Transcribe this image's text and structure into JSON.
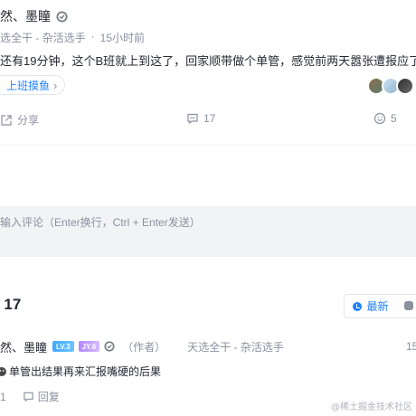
{
  "post": {
    "author": "然、墨瞳",
    "meta_title": "选全干 - 杂活选手",
    "meta_sep": "·",
    "time": "15小时前",
    "content": "还有19分钟，这个B班就上到这了，回家顺带做个单管，感觉前两天嚣张遭报应了",
    "topic": "上班摸鱼",
    "topic_more": "›"
  },
  "actions": {
    "share": "分享",
    "comments": "17",
    "likes": "5"
  },
  "comment_input": {
    "placeholder": "输入评论（Enter换行，Ctrl + Enter发送）"
  },
  "comments_section": {
    "title": "; 17",
    "sort_newest": "最新"
  },
  "reply": {
    "author": "然、墨瞳",
    "level_badge": "LV.3",
    "jy_badge": "JY.6",
    "author_tag": "（作者）",
    "title": "天选全干 - 杂活选手",
    "time": "15",
    "text": "单管出结果再来汇报嘴硬的后果",
    "likes": "1",
    "reply_label": "回复"
  },
  "watermark": "@稀土掘金技术社区",
  "colors": {
    "accent": "#1e80ff",
    "muted": "#8a919f",
    "text": "#252933"
  }
}
